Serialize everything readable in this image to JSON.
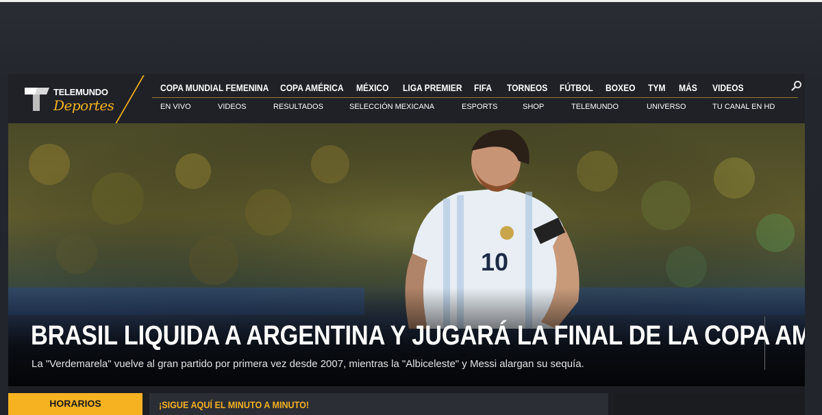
{
  "brand": {
    "word": "TELEMUNDO",
    "script": "Deportes",
    "accent_color": "#f6b221"
  },
  "primary_nav": [
    {
      "label": "COPA MUNDIAL FEMENINA"
    },
    {
      "label": "COPA AMÉRICA"
    },
    {
      "label": "MÉXICO"
    },
    {
      "label": "LIGA PREMIER"
    },
    {
      "label": "FIFA"
    },
    {
      "label": "TORNEOS"
    },
    {
      "label": "FÚTBOL"
    },
    {
      "label": "BOXEO"
    },
    {
      "label": "TYM"
    },
    {
      "label": "MÁS"
    },
    {
      "label": "VIDEOS"
    }
  ],
  "secondary_nav": [
    {
      "label": "EN VIVO"
    },
    {
      "label": "VIDEOS"
    },
    {
      "label": "RESULTADOS"
    },
    {
      "label": "SELECCIÓN MEXICANA"
    },
    {
      "label": "ESPORTS"
    },
    {
      "label": "SHOP"
    },
    {
      "label": "TELEMUNDO"
    },
    {
      "label": "UNIVERSO"
    },
    {
      "label": "TU CANAL EN HD"
    }
  ],
  "search": {
    "icon": "search-icon"
  },
  "hero": {
    "title": "BRASIL LIQUIDA A ARGENTINA Y JUGARÁ LA FINAL DE LA COPA AMÉRICA",
    "subtitle": "La \"Verdemarela\" vuelve al gran partido por primera vez desde 2007, mientras la \"Albiceleste\" y Messi alargan su sequía.",
    "jersey_number": "10"
  },
  "bottom": {
    "horarios_label": "HORARIOS",
    "ticker_label": "¡SIGUE AQUÍ EL MINUTO A MINUTO!"
  }
}
